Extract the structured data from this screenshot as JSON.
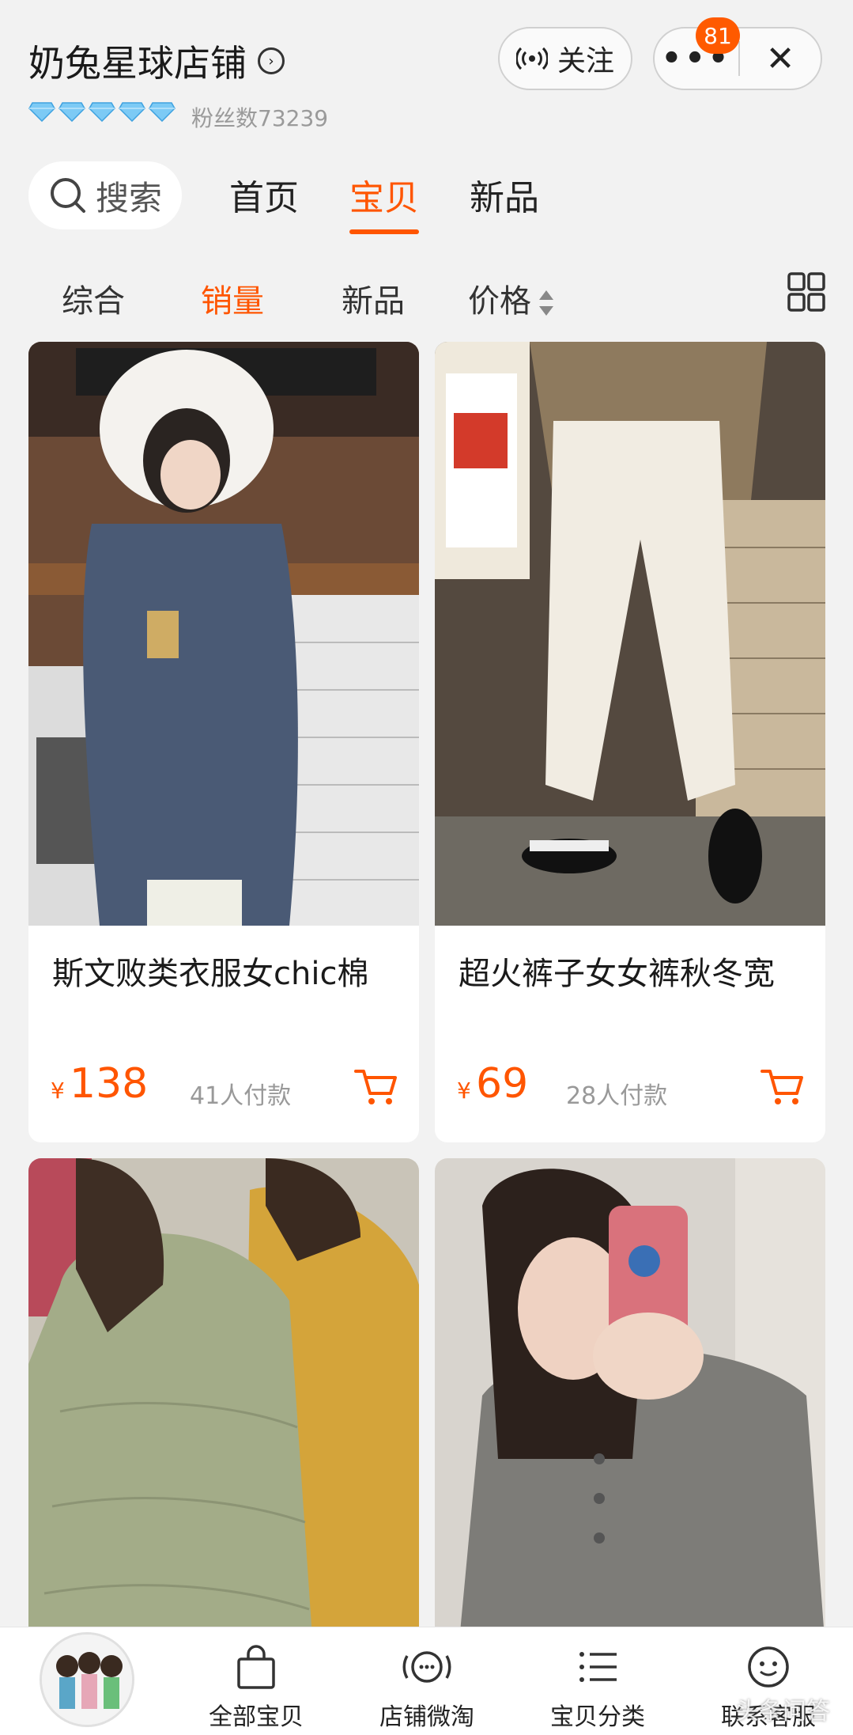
{
  "header": {
    "shop_name": "奶兔星球店铺",
    "fans": "粉丝数73239",
    "follow_label": "关注",
    "notification_count": "81",
    "diamond_count": 5
  },
  "nav": {
    "search_label": "搜索",
    "tabs": [
      "首页",
      "宝贝",
      "新品"
    ],
    "active_tab": "宝贝"
  },
  "sort": {
    "items": [
      "综合",
      "销量",
      "新品",
      "价格"
    ],
    "active": "销量"
  },
  "products": [
    {
      "title": "斯文败类衣服女chic棉",
      "currency": "¥",
      "price": "138",
      "paid": "41人付款"
    },
    {
      "title": "超火裤子女女裤秋冬宽",
      "currency": "¥",
      "price": "69",
      "paid": "28人付款"
    },
    {
      "title": "",
      "currency": "",
      "price": "",
      "paid": ""
    },
    {
      "title": "",
      "currency": "",
      "price": "",
      "paid": ""
    }
  ],
  "bottom_bar": {
    "items": [
      "全部宝贝",
      "店铺微淘",
      "宝贝分类",
      "联系客服"
    ]
  },
  "watermark": "头条问答",
  "colors": {
    "accent": "#ff5500",
    "badge": "#ff5a00"
  }
}
